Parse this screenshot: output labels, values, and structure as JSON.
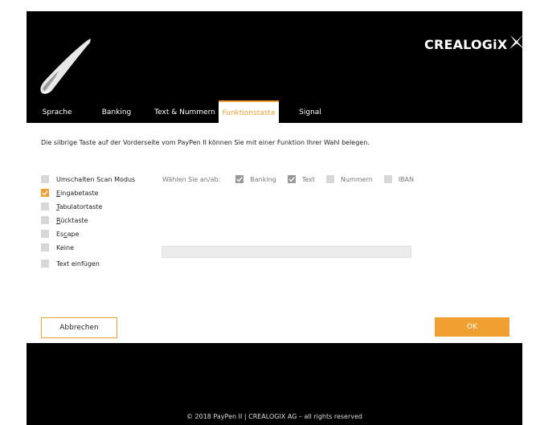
{
  "brand": {
    "name": "CREALOGIX",
    "name_part": "CREALOGi"
  },
  "tabs": [
    {
      "label": "Sprache",
      "active": false
    },
    {
      "label": "Banking",
      "active": false
    },
    {
      "label": "Text & Nummern",
      "active": false
    },
    {
      "label": "Funktionstaste",
      "active": true
    },
    {
      "label": "Signal",
      "active": false
    }
  ],
  "panel": {
    "intro": "Die silbrige Taste auf der Vorderseite vom PayPen II können Sie mit einer Funktion Ihrer Wahl belegen.",
    "options": [
      {
        "label": "Umschalten Scan Modus",
        "checked": false
      },
      {
        "label_prefix": "",
        "label_u": "E",
        "label_rest": "ingabetaste",
        "checked": true
      },
      {
        "label_prefix": "",
        "label_u": "T",
        "label_rest": "abulatortaste",
        "checked": false
      },
      {
        "label_prefix": "",
        "label_u": "R",
        "label_rest": "ücktaste",
        "checked": false
      },
      {
        "label_prefix": "Es",
        "label_u": "c",
        "label_rest": "ape",
        "checked": false
      },
      {
        "label": "Keine",
        "checked": false
      },
      {
        "label": "Text einfügen",
        "checked": false
      }
    ],
    "wahlen": {
      "label": "Wählen Sie an/ab:",
      "items": [
        {
          "label": "Banking",
          "checked": true
        },
        {
          "label": "Text",
          "checked": true
        },
        {
          "label": "Nummern",
          "checked": false
        },
        {
          "label": "IBAN",
          "checked": false
        }
      ]
    },
    "text_input_value": ""
  },
  "buttons": {
    "cancel": "Abbrechen",
    "ok": "OK"
  },
  "footer": "© 2018 PayPen II   |    CREALOGIX AG – all rights reserved",
  "colors": {
    "accent": "#f0a030",
    "background": "#000000",
    "panel": "#ffffff"
  }
}
